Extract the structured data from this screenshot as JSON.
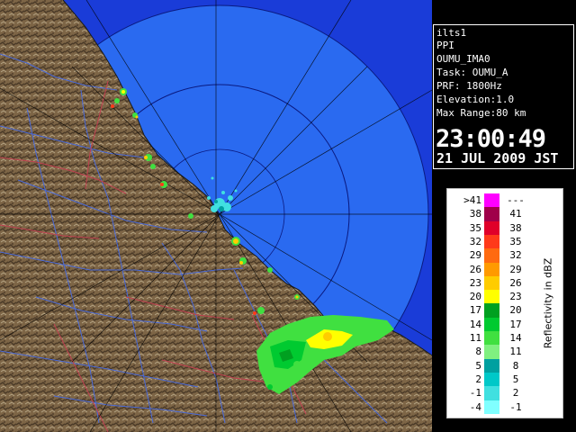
{
  "info": {
    "site": "ilts1",
    "product": "PPI",
    "product_name": "OUMU_IMA0",
    "task": "Task: OUMU_A",
    "prf": "PRF: 1800Hz",
    "elevation": "Elevation:1.0",
    "max_range": "Max Range:80 km",
    "time": "23:00:49",
    "date": "21 JUL 2009 JST"
  },
  "legend": {
    "title": "Reflectivity in dBZ",
    "rows": [
      {
        "lo": ">41",
        "hi": "---",
        "color": "#ff00ff"
      },
      {
        "lo": "38",
        "hi": "41",
        "color": "#a0004a"
      },
      {
        "lo": "35",
        "hi": "38",
        "color": "#e0002a"
      },
      {
        "lo": "32",
        "hi": "35",
        "color": "#ff3a1a"
      },
      {
        "lo": "29",
        "hi": "32",
        "color": "#ff6a10"
      },
      {
        "lo": "26",
        "hi": "29",
        "color": "#ff9a00"
      },
      {
        "lo": "23",
        "hi": "26",
        "color": "#ffcc00"
      },
      {
        "lo": "20",
        "hi": "23",
        "color": "#ffff00"
      },
      {
        "lo": "17",
        "hi": "20",
        "color": "#00a020"
      },
      {
        "lo": "14",
        "hi": "17",
        "color": "#00ca30"
      },
      {
        "lo": "11",
        "hi": "14",
        "color": "#40e040"
      },
      {
        "lo": "8",
        "hi": "11",
        "color": "#80f080"
      },
      {
        "lo": "5",
        "hi": "8",
        "color": "#00a0a0"
      },
      {
        "lo": "2",
        "hi": "5",
        "color": "#00c8c8"
      },
      {
        "lo": "-1",
        "hi": "2",
        "color": "#40e0e0"
      },
      {
        "lo": "-4",
        "hi": "-1",
        "color": "#80ffff"
      }
    ]
  },
  "colors": {
    "sea_outer": "#1a3cd8",
    "sea_inner": "#2a6af0",
    "land": "#7a6245",
    "land_dark": "#4a3a28",
    "river": "#4a6ad8",
    "boundary": "#c04050",
    "range_ring": "#0a1a80"
  }
}
